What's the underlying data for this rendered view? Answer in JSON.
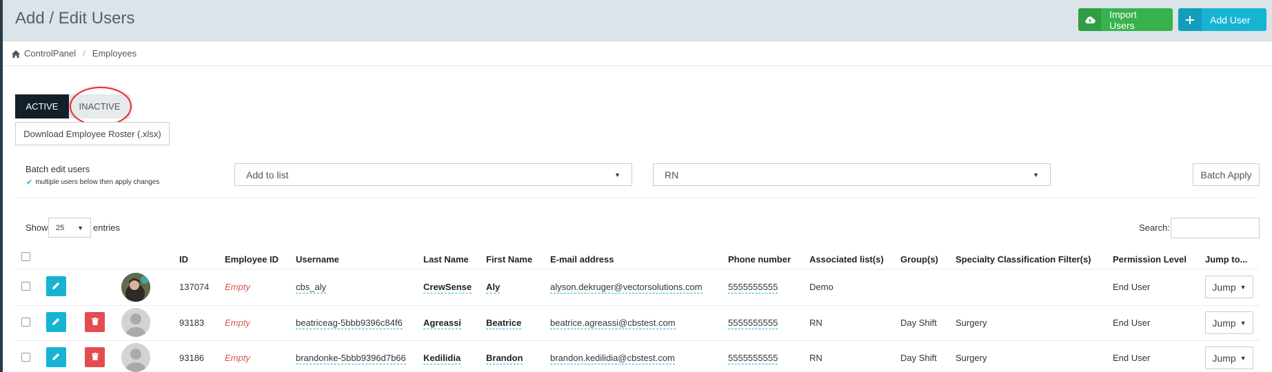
{
  "header": {
    "title": "Add / Edit Users",
    "import_label": "Import Users",
    "add_label": "Add User",
    "colors": {
      "import": "#37b24d",
      "add": "#17b3d3",
      "header_bg": "#dbe4e8"
    }
  },
  "breadcrumb": {
    "home": "ControlPanel",
    "current": "Employees"
  },
  "tabs": [
    {
      "label": "ACTIVE",
      "active": true
    },
    {
      "label": "INACTIVE",
      "active": false
    }
  ],
  "roster_button": "Download Employee Roster (.xlsx)",
  "batch": {
    "title": "Batch edit users",
    "hint": "multiple users below then apply changes",
    "action_selected": "Add to list",
    "list_selected": "RN",
    "apply_label": "Batch Apply"
  },
  "table_controls": {
    "show": "Show",
    "entries_value": "25",
    "entries": "entries",
    "search_label": "Search:"
  },
  "columns": {
    "id": "ID",
    "employee_id": "Employee ID",
    "username": "Username",
    "last_name": "Last Name",
    "first_name": "First Name",
    "email": "E-mail address",
    "phone": "Phone number",
    "lists": "Associated list(s)",
    "groups": "Group(s)",
    "specialty": "Specialty Classification Filter(s)",
    "permission": "Permission Level",
    "jump": "Jump to..."
  },
  "rows": [
    {
      "id": "137074",
      "employee_id": "Empty",
      "username": "cbs_aly",
      "last_name": "CrewSense",
      "first_name": "Aly",
      "email": "alyson.dekruger@vectorsolutions.com",
      "phone": "5555555555",
      "lists": "Demo",
      "groups": "",
      "specialty": "",
      "permission": "End User",
      "jump": "Jump",
      "avatar": "photo",
      "deletable": false
    },
    {
      "id": "93183",
      "employee_id": "Empty",
      "username": "beatriceag-5bbb9396c84f6",
      "last_name": "Agreassi",
      "first_name": "Beatrice",
      "email": "beatrice.agreassi@cbstest.com",
      "phone": "5555555555",
      "lists": "RN",
      "groups": "Day Shift",
      "specialty": "Surgery",
      "permission": "End User",
      "jump": "Jump",
      "avatar": "placeholder",
      "deletable": true
    },
    {
      "id": "93186",
      "employee_id": "Empty",
      "username": "brandonke-5bbb9396d7b66",
      "last_name": "Kedilidia",
      "first_name": "Brandon",
      "email": "brandon.kedilidia@cbstest.com",
      "phone": "5555555555",
      "lists": "RN",
      "groups": "Day Shift",
      "specialty": "Surgery",
      "permission": "End User",
      "jump": "Jump",
      "avatar": "placeholder",
      "deletable": true
    }
  ]
}
